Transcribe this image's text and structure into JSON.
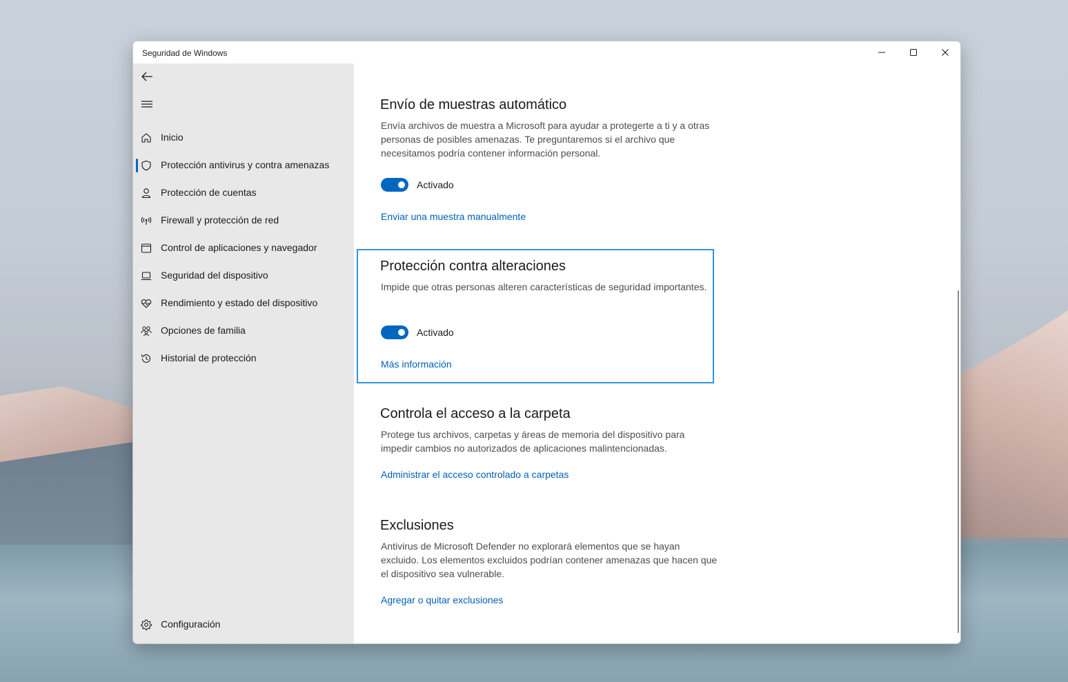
{
  "window": {
    "title": "Seguridad de Windows",
    "controls": [
      "minimize-icon",
      "maximize-icon",
      "close-icon"
    ]
  },
  "sidebar": {
    "items": [
      {
        "label": "Inicio",
        "icon": "home-icon"
      },
      {
        "label": "Protección antivirus y contra amenazas",
        "icon": "shield-icon",
        "selected": true
      },
      {
        "label": "Protección de cuentas",
        "icon": "person-icon"
      },
      {
        "label": "Firewall y protección de red",
        "icon": "wifi-antenna-icon"
      },
      {
        "label": "Control de aplicaciones y navegador",
        "icon": "app-window-icon"
      },
      {
        "label": "Seguridad del dispositivo",
        "icon": "laptop-icon"
      },
      {
        "label": "Rendimiento y estado del dispositivo",
        "icon": "heart-pulse-icon"
      },
      {
        "label": "Opciones de familia",
        "icon": "family-icon"
      },
      {
        "label": "Historial de protección",
        "icon": "history-icon"
      }
    ],
    "settings_label": "Configuración"
  },
  "sections": [
    {
      "title": "Envío de muestras automático",
      "description": "Envía archivos de muestra a Microsoft para ayudar a protegerte a ti y a otras personas de posibles amenazas. Te preguntaremos si el archivo que necesitamos podría contener información personal.",
      "toggle_label": "Activado",
      "toggle_on": true,
      "link": "Enviar una muestra manualmente"
    },
    {
      "title": "Protección contra alteraciones",
      "description": "Impide que otras personas alteren características de seguridad importantes.",
      "toggle_label": "Activado",
      "toggle_on": true,
      "link": "Más información"
    },
    {
      "title": "Controla el acceso a la carpeta",
      "description": "Protege tus archivos, carpetas y áreas de memoria del dispositivo para impedir cambios no autorizados de aplicaciones malintencionadas.",
      "link": "Administrar el acceso controlado a carpetas"
    },
    {
      "title": "Exclusiones",
      "description": "Antivirus de Microsoft Defender no explorará elementos que se hayan excluido. Los elementos excluidos podrían contener amenazas que hacen que el dispositivo sea vulnerable.",
      "link": "Agregar o quitar exclusiones"
    }
  ],
  "colors": {
    "accent": "#0067c0",
    "link": "#005fb8",
    "focus": "#2f93e0",
    "sidebar_bg": "#e8e8e8"
  }
}
